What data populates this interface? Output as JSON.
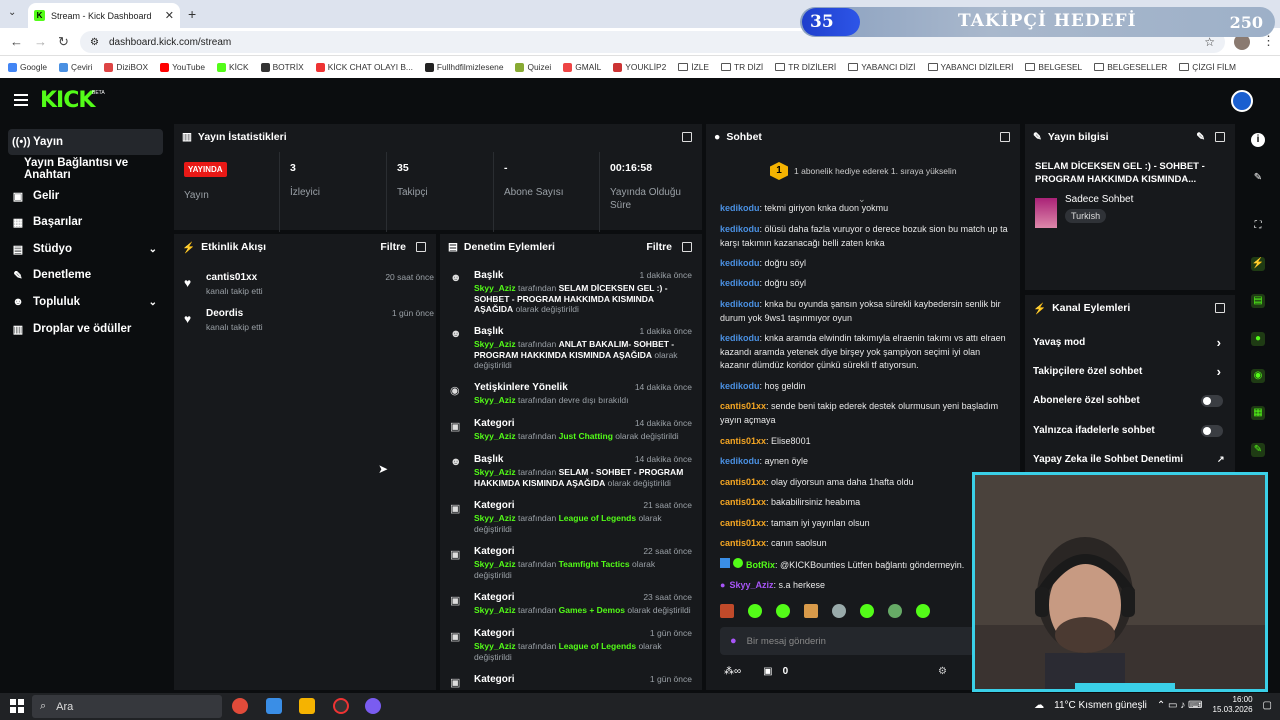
{
  "browser": {
    "tab_title": "Stream - Kick Dashboard",
    "url": "dashboard.kick.com/stream",
    "bookmarks": [
      "Google",
      "Çeviri",
      "DiziBOX",
      "YouTube",
      "KİCK",
      "BOTRİX",
      "KİCK CHAT OLAYI B...",
      "Fullhdfilmizlesene",
      "Quizei",
      "GMAİL",
      "YOUKLİP2",
      "İZLE",
      "TR DİZİ",
      "TR DİZİLERİ",
      "YABANCI DİZİ",
      "YABANCI DİZİLERİ",
      "BELGESEL",
      "BELGESELLER",
      "ÇİZGİ FİLM"
    ]
  },
  "overlay": {
    "current": "35",
    "title": "TAKİPÇİ HEDEFİ",
    "target": "250"
  },
  "sidebar": {
    "items": [
      {
        "label": "Yayın",
        "icon": "broadcast-icon"
      },
      {
        "label": "Yayın Bağlantısı ve Anahtarı",
        "icon": ""
      },
      {
        "label": "Gelir",
        "icon": "wallet-icon"
      },
      {
        "label": "Başarılar",
        "icon": "calendar-icon"
      },
      {
        "label": "Stüdyo",
        "icon": "layout-icon"
      },
      {
        "label": "Denetleme",
        "icon": "wrench-icon"
      },
      {
        "label": "Topluluk",
        "icon": "users-icon"
      },
      {
        "label": "Droplar ve ödüller",
        "icon": "gift-icon"
      }
    ]
  },
  "stats": {
    "title": "Yayın İstatistikleri",
    "live_badge": "YAYINDA",
    "live_label": "Yayın",
    "viewers": {
      "value": "3",
      "label": "İzleyici"
    },
    "followers": {
      "value": "35",
      "label": "Takipçi"
    },
    "subs": {
      "value": "-",
      "label": "Abone Sayısı"
    },
    "uptime": {
      "value": "00:16:58",
      "label": "Yayında Olduğu Süre"
    }
  },
  "activity": {
    "title": "Etkinlik Akışı",
    "filter": "Filtre",
    "items": [
      {
        "name": "cantis01xx",
        "sub": "kanalı takip etti",
        "time": "20 saat önce"
      },
      {
        "name": "Deordis",
        "sub": "kanalı takip etti",
        "time": "1 gün önce"
      }
    ]
  },
  "moderation": {
    "title": "Denetim Eylemleri",
    "filter": "Filtre",
    "items": [
      {
        "head": "Başlık",
        "time": "1 dakika önce",
        "user": "Skyy_Aziz",
        "mid": " tarafından ",
        "value": "SELAM DİCEKSEN GEL :) - SOHBET - PROGRAM HAKKIMDA KISMINDA AŞAĞIDA",
        "tail": " olarak değiştirildi"
      },
      {
        "head": "Başlık",
        "time": "1 dakika önce",
        "user": "Skyy_Aziz",
        "mid": " tarafından ",
        "value": "ANLAT BAKALIM- SOHBET - PROGRAM HAKKIMDA KISMINDA AŞAĞIDA",
        "tail": " olarak değiştirildi"
      },
      {
        "head": "Yetişkinlere Yönelik",
        "time": "14 dakika önce",
        "user": "Skyy_Aziz",
        "mid": " tarafından devre dışı bırakıldı",
        "value": "",
        "tail": ""
      },
      {
        "head": "Kategori",
        "time": "14 dakika önce",
        "user": "Skyy_Aziz",
        "mid": " tarafından ",
        "value": "Just Chatting",
        "tail": " olarak değiştirildi"
      },
      {
        "head": "Başlık",
        "time": "14 dakika önce",
        "user": "Skyy_Aziz",
        "mid": " tarafından ",
        "value": "SELAM - SOHBET - PROGRAM HAKKIMDA KISMINDA AŞAĞIDA",
        "tail": " olarak değiştirildi"
      },
      {
        "head": "Kategori",
        "time": "21 saat önce",
        "user": "Skyy_Aziz",
        "mid": " tarafından ",
        "value": "League of Legends",
        "tail": " olarak değiştirildi"
      },
      {
        "head": "Kategori",
        "time": "22 saat önce",
        "user": "Skyy_Aziz",
        "mid": " tarafından ",
        "value": "Teamfight Tactics",
        "tail": " olarak değiştirildi"
      },
      {
        "head": "Kategori",
        "time": "23 saat önce",
        "user": "Skyy_Aziz",
        "mid": " tarafından ",
        "value": "Games + Demos",
        "tail": " olarak değiştirildi"
      },
      {
        "head": "Kategori",
        "time": "1 gün önce",
        "user": "Skyy_Aziz",
        "mid": " tarafından ",
        "value": "League of Legends",
        "tail": " olarak değiştirildi"
      },
      {
        "head": "Kategori",
        "time": "1 gün önce",
        "user": "",
        "mid": "",
        "value": "",
        "tail": ""
      }
    ]
  },
  "chat": {
    "title": "Sohbet",
    "sub_banner": "1 abonelik hediye ederek 1. sıraya yükselin",
    "placeholder": "Bir mesaj gönderin",
    "counter": "0",
    "messages": [
      {
        "user": "kedikodu",
        "cls": "cu",
        "text": ": tekmi giriyon knka duon yokmu"
      },
      {
        "user": "kedikodu",
        "cls": "cu",
        "text": ": ölüsü daha fazla vuruyor o derece bozuk sion bu match up ta karşı takımın kazanacağı belli zaten knka"
      },
      {
        "user": "kedikodu",
        "cls": "cu",
        "text": ": doğru söyl"
      },
      {
        "user": "kedikodu",
        "cls": "cu",
        "text": ": doğru söyl"
      },
      {
        "user": "kedikodu",
        "cls": "cu",
        "text": ": knka bu oyunda şansın yoksa sürekli kaybedersin senlik bir durum yok 9ws1 taşınmıyor oyun"
      },
      {
        "user": "kedikodu",
        "cls": "cu",
        "text": ": knka aramda elwindin takımıyla elraenin takımı vs attı elraen kazandı aramda yetenek diye birşey yok şampiyon seçimi iyi olan kazanır dümdüz koridor çünkü sürekli tf atıyorsun."
      },
      {
        "user": "kedikodu",
        "cls": "cu",
        "text": ": hoş geldin"
      },
      {
        "user": "cantis01xx",
        "cls": "co",
        "text": ": sende beni takip ederek destek olurmusun yeni başladım yayın açmaya"
      },
      {
        "user": "cantis01xx",
        "cls": "co",
        "text": ": Elise8001"
      },
      {
        "user": "kedikodu",
        "cls": "cu",
        "text": ": aynen öyle"
      },
      {
        "user": "cantis01xx",
        "cls": "co",
        "text": ": olay diyorsun ama daha 1hafta oldu"
      },
      {
        "user": "cantis01xx",
        "cls": "co",
        "text": ": bakabilirsiniz heabıma"
      },
      {
        "user": "cantis01xx",
        "cls": "co",
        "text": ": tamam iyi yayınlan olsun"
      },
      {
        "user": "cantis01xx",
        "cls": "co",
        "text": ": canın saolsun"
      },
      {
        "user": "BotRix",
        "cls": "cb",
        "text": ": @KICKBounties Lütfen bağlantı göndermeyin."
      },
      {
        "user": "Skyy_Aziz",
        "cls": "cp",
        "text": ": s.a herkese"
      }
    ]
  },
  "stream_info": {
    "title": "Yayın bilgisi",
    "stream_title": "SELAM DİCEKSEN GEL :) - SOHBET - PROGRAM HAKKIMDA KISMINDA...",
    "category": "Sadece Sohbet",
    "language": "Turkish"
  },
  "channel_actions": {
    "title": "Kanal Eylemleri",
    "items": [
      {
        "label": "Yavaş mod",
        "kind": "chevron"
      },
      {
        "label": "Takipçilere özel sohbet",
        "kind": "chevron"
      },
      {
        "label": "Abonelere özel sohbet",
        "kind": "toggle"
      },
      {
        "label": "Yalnızca ifadelerle sohbet",
        "kind": "toggle"
      },
      {
        "label": "Yapay Zeka ile Sohbet Denetimi",
        "kind": "external"
      }
    ]
  },
  "taskbar": {
    "search": "Ara",
    "weather": "11°C  Kısmen güneşli",
    "time": "16:00",
    "date": "15.03.2026"
  }
}
